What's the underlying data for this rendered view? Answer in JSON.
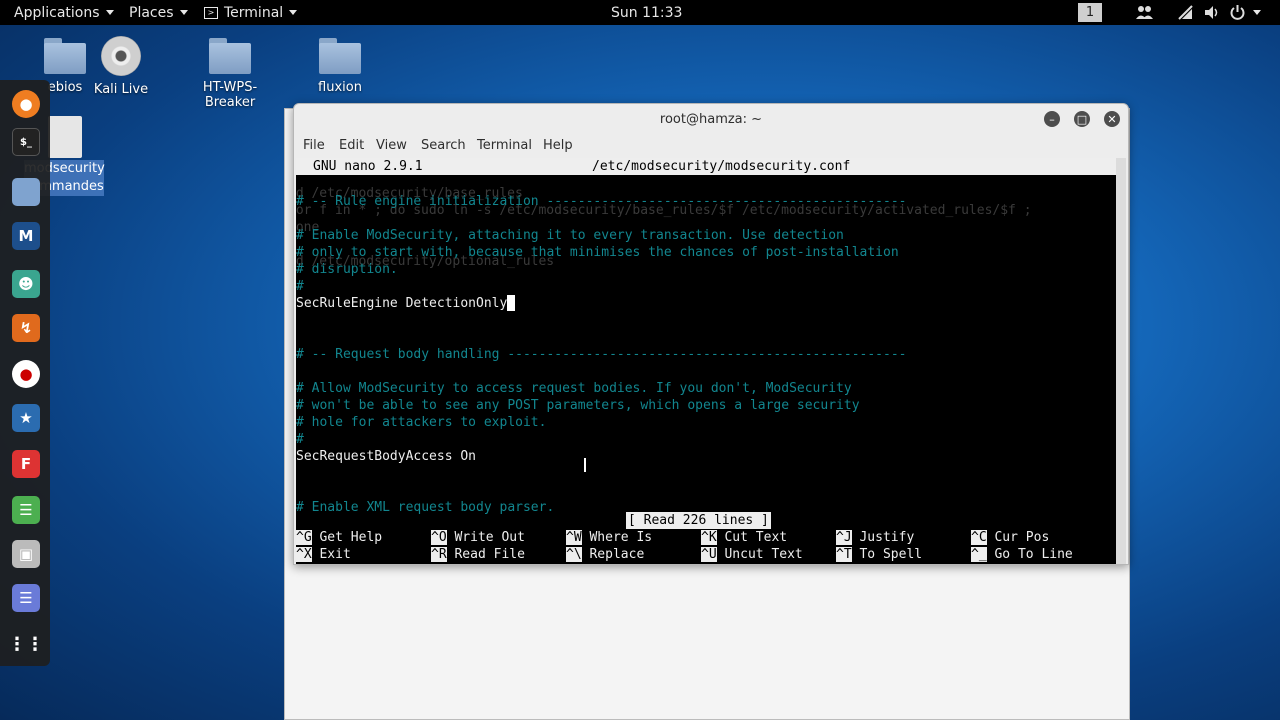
{
  "topbar": {
    "applications": "Applications",
    "places": "Places",
    "terminal": "Terminal",
    "clock": "Sun 11:33",
    "workspace": "1"
  },
  "desktop": {
    "icons": [
      {
        "label": "ebios"
      },
      {
        "label": "Kali Live"
      },
      {
        "label": "HT-WPS-Breaker"
      },
      {
        "label": "fluxion"
      }
    ],
    "file_label_1": "modsecurity",
    "file_label_2": "commandes"
  },
  "window": {
    "title": "root@hamza: ~",
    "menu": [
      "File",
      "Edit",
      "View",
      "Search",
      "Terminal",
      "Help"
    ]
  },
  "nano": {
    "version": "GNU nano 2.9.1",
    "filename": "/etc/modsecurity/modsecurity.conf",
    "lines": [
      {
        "text": "# -- Rule engine initialization ----------------------------------------------",
        "style": "cmt"
      },
      {
        "text": "",
        "style": ""
      },
      {
        "text": "# Enable ModSecurity, attaching it to every transaction. Use detection",
        "style": "cmt"
      },
      {
        "text": "# only to start with, because that minimises the chances of post-installation",
        "style": "cmt"
      },
      {
        "text": "# disruption.",
        "style": "cmt"
      },
      {
        "text": "#",
        "style": "cmt"
      },
      {
        "text": "SecRuleEngine DetectionOnly",
        "style": "cursor"
      },
      {
        "text": "",
        "style": ""
      },
      {
        "text": "",
        "style": ""
      },
      {
        "text": "# -- Request body handling ---------------------------------------------------",
        "style": "cmt"
      },
      {
        "text": "",
        "style": ""
      },
      {
        "text": "# Allow ModSecurity to access request bodies. If you don't, ModSecurity",
        "style": "cmt"
      },
      {
        "text": "# won't be able to see any POST parameters, which opens a large security",
        "style": "cmt"
      },
      {
        "text": "# hole for attackers to exploit.",
        "style": "cmt"
      },
      {
        "text": "#",
        "style": "cmt"
      },
      {
        "text": "SecRequestBodyAccess On",
        "style": ""
      },
      {
        "text": "",
        "style": ""
      },
      {
        "text": "",
        "style": ""
      },
      {
        "text": "# Enable XML request body parser.",
        "style": "cmt"
      }
    ],
    "ghost_lines": [
      "cd /etc/modsecurity/base_rules",
      "for f in * ; do sudo ln -s /etc/modsecurity/base_rules/$f /etc/modsecurity/activated_rules/$f ;",
      "done",
      "cd /etc/modsecurity/optional_rules"
    ],
    "status": "[ Read 226 lines ]",
    "shortcuts_row1": [
      {
        "key": "^G",
        "label": "Get Help"
      },
      {
        "key": "^O",
        "label": "Write Out"
      },
      {
        "key": "^W",
        "label": "Where Is"
      },
      {
        "key": "^K",
        "label": "Cut Text"
      },
      {
        "key": "^J",
        "label": "Justify"
      },
      {
        "key": "^C",
        "label": "Cur Pos"
      }
    ],
    "shortcuts_row2": [
      {
        "key": "^X",
        "label": "Exit"
      },
      {
        "key": "^R",
        "label": "Read File"
      },
      {
        "key": "^\\",
        "label": "Replace"
      },
      {
        "key": "^U",
        "label": "Uncut Text"
      },
      {
        "key": "^T",
        "label": "To Spell"
      },
      {
        "key": "^_",
        "label": "Go To Line"
      }
    ]
  },
  "colors": {
    "comment": "#12868f",
    "topbar_bg": "#000000"
  }
}
